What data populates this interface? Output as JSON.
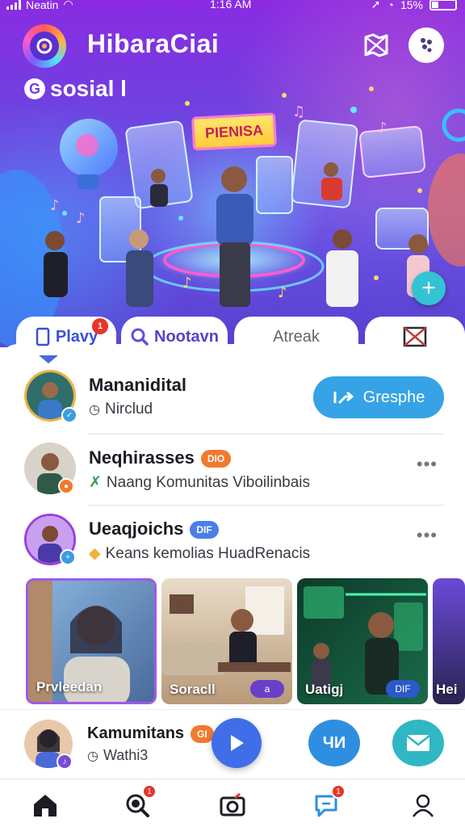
{
  "status_bar": {
    "carrier": "Neatin",
    "time": "1:16 AM",
    "battery": "15%"
  },
  "header": {
    "title": "HibaraCiai",
    "sub_brand": "sosial l",
    "hero_sign": "PIENISA"
  },
  "tabs": [
    {
      "label": "Plavy",
      "badge": "1"
    },
    {
      "label": "Nootavn"
    },
    {
      "label": "Atreak"
    },
    {
      "label": ""
    }
  ],
  "list": [
    {
      "name": "Mananidital",
      "meta": "Nirclud",
      "cta_label": "Gresphe"
    },
    {
      "name": "Neqhirasses",
      "badge": "DIO",
      "meta": "Naang Komunitas Viboilinbais"
    },
    {
      "name": "Ueaqjoichs",
      "badge": "DIF",
      "meta": "Keans kemolias HuadRenacis"
    }
  ],
  "carousel": [
    {
      "caption": "Prvleedan",
      "chip": ""
    },
    {
      "caption": "Soracll",
      "chip": "a"
    },
    {
      "caption": "Uatigj",
      "chip": "DIF"
    },
    {
      "caption": "Hei",
      "chip": ""
    }
  ],
  "player": {
    "name": "Kamumitans",
    "badge": "GI",
    "meta": "Wathi3",
    "mid_button": "ЧИ"
  },
  "nav": {
    "search_badge": "1",
    "chat_badge": "1"
  },
  "colors": {
    "accent_blue": "#35a3e6",
    "play_blue": "#3f6ee8",
    "teal": "#2fb7c4",
    "badge_red": "#e8352b",
    "badge_orange": "#f07a2e",
    "badge_blue": "#4a7ee8",
    "hero_purple": "#7040e0"
  }
}
